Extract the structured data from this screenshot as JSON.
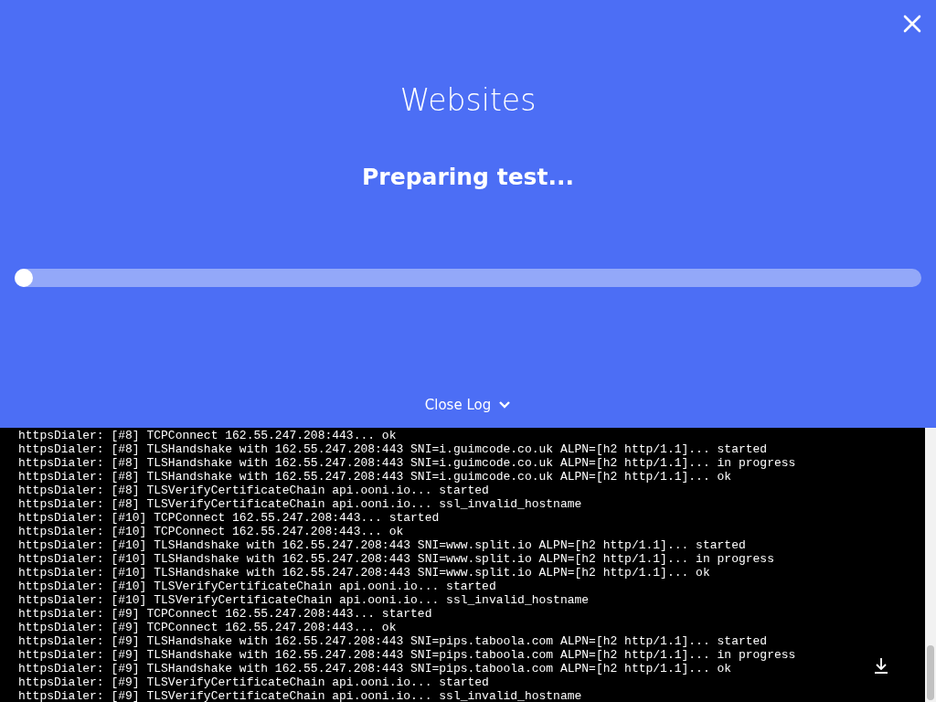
{
  "header": {
    "title": "Websites",
    "status": "Preparing test...",
    "progress": {
      "level": 0
    }
  },
  "log_toggle": {
    "label": "Close Log",
    "expanded": true
  },
  "log": {
    "lines": [
      "httpsDialer: [#8] TCPConnect 162.55.247.208:443... ok",
      "httpsDialer: [#8] TLSHandshake with 162.55.247.208:443 SNI=i.guimcode.co.uk ALPN=[h2 http/1.1]... started",
      "httpsDialer: [#8] TLSHandshake with 162.55.247.208:443 SNI=i.guimcode.co.uk ALPN=[h2 http/1.1]... in progress",
      "httpsDialer: [#8] TLSHandshake with 162.55.247.208:443 SNI=i.guimcode.co.uk ALPN=[h2 http/1.1]... ok",
      "httpsDialer: [#8] TLSVerifyCertificateChain api.ooni.io... started",
      "httpsDialer: [#8] TLSVerifyCertificateChain api.ooni.io... ssl_invalid_hostname",
      "httpsDialer: [#10] TCPConnect 162.55.247.208:443... started",
      "httpsDialer: [#10] TCPConnect 162.55.247.208:443... ok",
      "httpsDialer: [#10] TLSHandshake with 162.55.247.208:443 SNI=www.split.io ALPN=[h2 http/1.1]... started",
      "httpsDialer: [#10] TLSHandshake with 162.55.247.208:443 SNI=www.split.io ALPN=[h2 http/1.1]... in progress",
      "httpsDialer: [#10] TLSHandshake with 162.55.247.208:443 SNI=www.split.io ALPN=[h2 http/1.1]... ok",
      "httpsDialer: [#10] TLSVerifyCertificateChain api.ooni.io... started",
      "httpsDialer: [#10] TLSVerifyCertificateChain api.ooni.io... ssl_invalid_hostname",
      "httpsDialer: [#9] TCPConnect 162.55.247.208:443... started",
      "httpsDialer: [#9] TCPConnect 162.55.247.208:443... ok",
      "httpsDialer: [#9] TLSHandshake with 162.55.247.208:443 SNI=pips.taboola.com ALPN=[h2 http/1.1]... started",
      "httpsDialer: [#9] TLSHandshake with 162.55.247.208:443 SNI=pips.taboola.com ALPN=[h2 http/1.1]... in progress",
      "httpsDialer: [#9] TLSHandshake with 162.55.247.208:443 SNI=pips.taboola.com ALPN=[h2 http/1.1]... ok",
      "httpsDialer: [#9] TLSVerifyCertificateChain api.ooni.io... started",
      "httpsDialer: [#9] TLSVerifyCertificateChain api.ooni.io... ssl_invalid_hostname"
    ]
  }
}
